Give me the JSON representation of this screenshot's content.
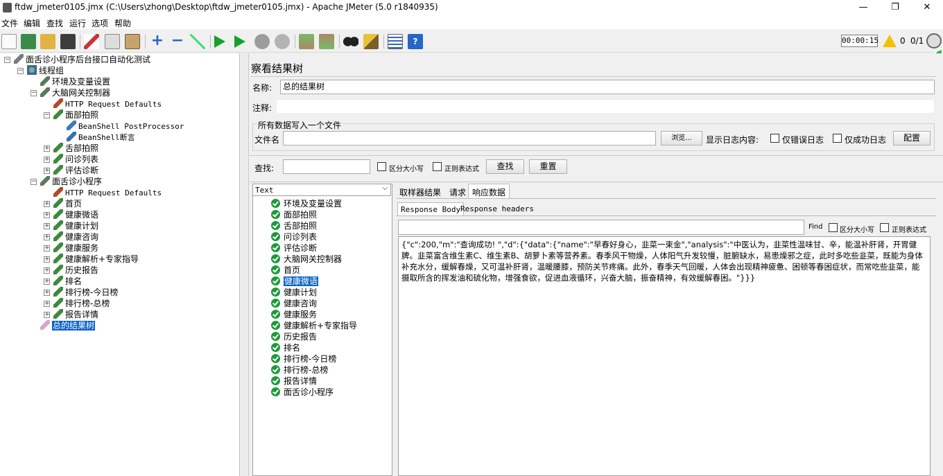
{
  "window": {
    "title": "ftdw_jmeter0105.jmx (C:\\Users\\zhong\\Desktop\\ftdw_jmeter0105.jmx) - Apache JMeter (5.0 r1840935)",
    "minimize": "—",
    "restore": "❐",
    "close": "✕"
  },
  "menu": [
    "文件",
    "编辑",
    "查找",
    "运行",
    "选项",
    "帮助"
  ],
  "toolbar": {
    "timer": "00:00:15",
    "warn_count": "0",
    "threads": "0/1",
    "icons": [
      "new-icon",
      "templates-icon",
      "open-icon",
      "save-icon",
      "cut-icon",
      "copy-icon",
      "paste-icon",
      "expand-icon",
      "collapse-icon",
      "toggle-icon",
      "start-icon",
      "start-no-pause-icon",
      "stop-icon",
      "shutdown-icon",
      "clear-icon",
      "clear-all-icon",
      "search-icon",
      "reset-search-icon",
      "function-helper-icon",
      "help-icon"
    ]
  },
  "tree": {
    "root": "面舌诊小程序后台接口自动化测试",
    "thread_group": "线程组",
    "items": [
      {
        "label": "环境及变量设置",
        "indent": 3
      },
      {
        "label": "大脑网关控制器",
        "indent": 3
      },
      {
        "label": "HTTP Request Defaults",
        "indent": 4,
        "mono": true
      },
      {
        "label": "面部拍照",
        "indent": 4
      },
      {
        "label": "BeanShell PostProcessor",
        "indent": 5,
        "mono": true
      },
      {
        "label": "BeanShell断言",
        "indent": 5,
        "mono": true
      },
      {
        "label": "舌部拍照",
        "indent": 4
      },
      {
        "label": "问诊列表",
        "indent": 4
      },
      {
        "label": "评估诊断",
        "indent": 4
      },
      {
        "label": "面舌诊小程序",
        "indent": 3
      },
      {
        "label": "HTTP Request Defaults",
        "indent": 4,
        "mono": true
      },
      {
        "label": "首页",
        "indent": 4
      },
      {
        "label": "健康微语",
        "indent": 4
      },
      {
        "label": "健康计划",
        "indent": 4
      },
      {
        "label": "健康咨询",
        "indent": 4
      },
      {
        "label": "健康服务",
        "indent": 4
      },
      {
        "label": "健康解析+专家指导",
        "indent": 4
      },
      {
        "label": "历史报告",
        "indent": 4
      },
      {
        "label": "排名",
        "indent": 4
      },
      {
        "label": "排行榜-今日榜",
        "indent": 4
      },
      {
        "label": "排行榜-总榜",
        "indent": 4
      },
      {
        "label": "报告详情",
        "indent": 4
      },
      {
        "label": "总的结果树",
        "indent": 3,
        "selected": true
      }
    ]
  },
  "panel": {
    "title": "察看结果树",
    "name_label": "名称:",
    "name_value": "总的结果树",
    "comment_label": "注释:",
    "comment_value": "",
    "file_group": "所有数据写入一个文件",
    "filename_label": "文件名",
    "filename_value": "",
    "browse": "浏览...",
    "log_label": "显示日志内容:",
    "errors_only": "仅错误日志",
    "success_only": "仅成功日志",
    "configure": "配置",
    "search_label": "查找:",
    "search_value": "",
    "case_sensitive": "区分大小写",
    "regex": "正则表达式",
    "find_btn": "查找",
    "reset_btn": "重置",
    "renderer": "Text",
    "tabs": [
      "取样器结果",
      "请求",
      "响应数据"
    ],
    "subtabs": [
      "Response Body",
      "Response headers"
    ],
    "find_small": "Find",
    "case_small": "区分大小写",
    "regex_small": "正则表达式",
    "results": [
      "环境及变量设置",
      "面部拍照",
      "舌部拍照",
      "问诊列表",
      "评估诊断",
      "大脑网关控制器",
      "首页",
      "健康微语",
      "健康计划",
      "健康咨询",
      "健康服务",
      "健康解析+专家指导",
      "历史报告",
      "排名",
      "排行榜-今日榜",
      "排行榜-总榜",
      "报告详情",
      "面舌诊小程序"
    ],
    "selected_result": "健康微语",
    "response": "{\"c\":200,\"m\":\"查询成功! \",\"d\":{\"data\":{\"name\":\"早春好身心，韭菜一束金\",\"analysis\":\"中医认为，韭菜性温味甘、辛，能温补肝肾，开胃健脾。韭菜富含维生素C、维生素B、胡萝卜素等营养素。春季风干物燥，人体阳气升发较慢，脏腑缺水，易患燥邪之症，此时多吃些韭菜，既能为身体补充水分，缓解春燥，又可温补肝肾，温暖腰膝，预防关节疼痛。此外，春季天气回暖，人体会出现精神疲惫、困顿等春困症状，而常吃些韭菜，能摄取所含的挥发油和硫化物，增强食欲，促进血液循环，兴奋大脑，振奋精神，有效缓解春困。\"}}}"
  }
}
